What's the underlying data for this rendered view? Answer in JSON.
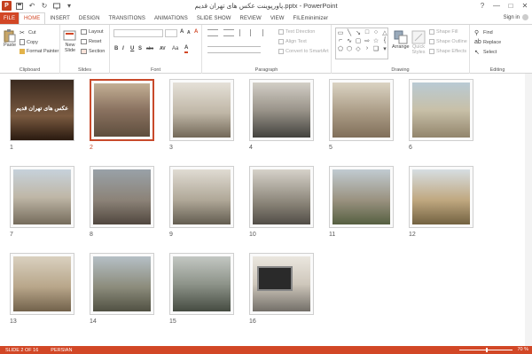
{
  "window": {
    "title": "پاورپوینت عکس های تهران قدیم.pptx - PowerPoint",
    "app_icon": "P",
    "controls": [
      "?",
      "—",
      "□",
      "✕"
    ]
  },
  "quick_access": [
    "save-icon",
    "undo-icon",
    "redo-icon",
    "slideshow-icon",
    "customize-icon"
  ],
  "tabs": [
    "FILE",
    "HOME",
    "INSERT",
    "DESIGN",
    "TRANSITIONS",
    "ANIMATIONS",
    "SLIDE SHOW",
    "REVIEW",
    "VIEW",
    "FILEminimizer"
  ],
  "active_tab": "HOME",
  "signin": "Sign in",
  "ribbon": {
    "clipboard": {
      "paste": "Paste",
      "cut": "Cut",
      "copy": "Copy",
      "format_painter": "Format Painter",
      "label": "Clipboard"
    },
    "slides": {
      "new_slide": "New",
      "new_slide2": "Slide",
      "layout": "Layout",
      "reset": "Reset",
      "section": "Section",
      "label": "Slides"
    },
    "font": {
      "bold": "B",
      "italic": "I",
      "underline": "U",
      "strike": "S",
      "shadow": "abc",
      "spacing": "AV",
      "case": "Aa",
      "grow": "A",
      "shrink": "A",
      "clear": "A",
      "label": "Font"
    },
    "paragraph": {
      "text_direction": "Text Direction",
      "align_text": "Align Text",
      "smartart": "Convert to SmartArt",
      "label": "Paragraph"
    },
    "drawing": {
      "arrange": "Arrange",
      "quick_styles": "Quick",
      "quick_styles2": "Styles",
      "shape_fill": "Shape Fill",
      "shape_outline": "Shape Outline",
      "shape_effects": "Shape Effects",
      "label": "Drawing"
    },
    "editing": {
      "find": "Find",
      "replace": "Replace",
      "select": "Select",
      "label": "Editing"
    }
  },
  "slides": [
    {
      "num": "1",
      "title": "عکس های تهران قدیم",
      "selected": false
    },
    {
      "num": "2",
      "selected": true
    },
    {
      "num": "3",
      "selected": false
    },
    {
      "num": "4",
      "selected": false
    },
    {
      "num": "5",
      "selected": false
    },
    {
      "num": "6",
      "selected": false
    },
    {
      "num": "7",
      "selected": false
    },
    {
      "num": "8",
      "selected": false
    },
    {
      "num": "9",
      "selected": false
    },
    {
      "num": "10",
      "selected": false
    },
    {
      "num": "11",
      "selected": false
    },
    {
      "num": "12",
      "selected": false
    },
    {
      "num": "13",
      "selected": false
    },
    {
      "num": "14",
      "selected": false
    },
    {
      "num": "15",
      "selected": false
    },
    {
      "num": "16",
      "selected": false
    }
  ],
  "status": {
    "slide": "SLIDE 2 OF 16",
    "language": "PERSIAN",
    "zoom": "70 %"
  },
  "colors": {
    "accent": "#d24726",
    "selected_border": "#c84a2b"
  }
}
